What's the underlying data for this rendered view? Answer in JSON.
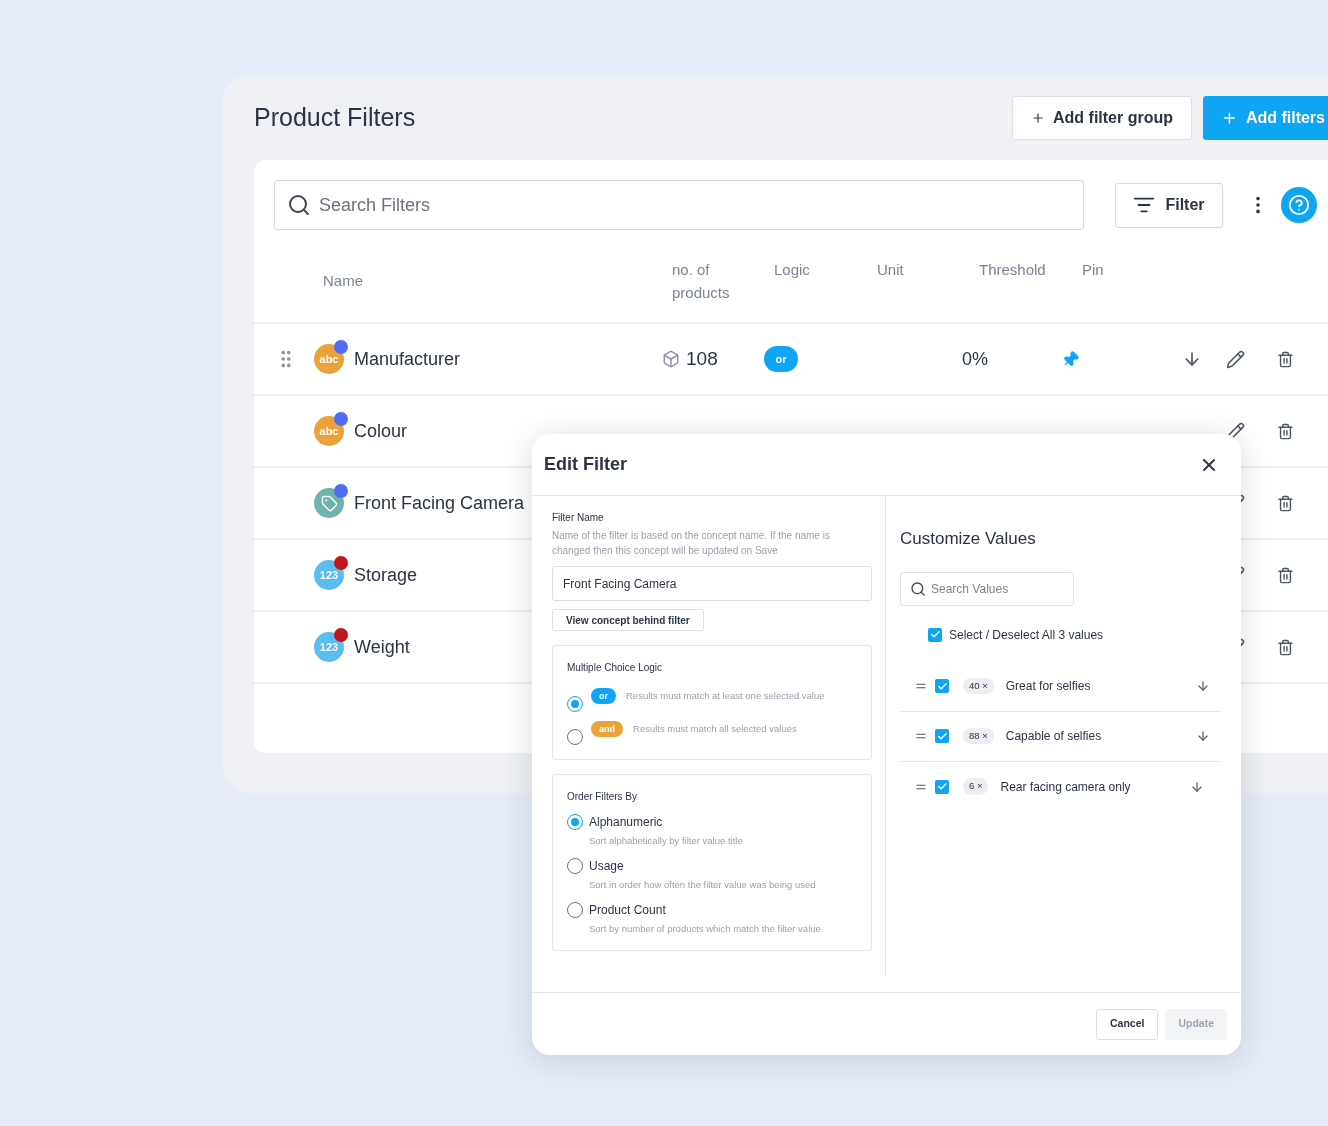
{
  "page": {
    "title": "Product Filters",
    "buttons": [
      {
        "label": "Add filter group",
        "kind": "secondary"
      },
      {
        "label": "Add filters",
        "kind": "primary"
      }
    ]
  },
  "toolbar": {
    "search_placeholder": "Search Filters",
    "filter_button": "Filter"
  },
  "table": {
    "columns": [
      "Name",
      "no. of products",
      "Logic",
      "Unit",
      "Threshold",
      "Pin"
    ],
    "rows": [
      {
        "name": "Manufacturer",
        "kind": "text",
        "type_label": "abc",
        "color": "#4f6ef7",
        "count": "108",
        "logic": "or",
        "threshold": "0%",
        "pinned": true,
        "sort_descending": true,
        "drag": true
      },
      {
        "name": "Colour",
        "kind": "text",
        "type_label": "abc",
        "color": "#4f6ef7",
        "drag": false
      },
      {
        "name": "Front Facing Camera",
        "kind": "tag",
        "color": "#4f6ef7",
        "drag": false
      },
      {
        "name": "Storage",
        "kind": "number",
        "type_label": "123",
        "color": "#c0161c",
        "drag": false
      },
      {
        "name": "Weight",
        "kind": "number",
        "type_label": "123",
        "color": "#c0161c",
        "drag": false
      }
    ]
  },
  "dialog": {
    "title": "Edit Filter",
    "filter_name": {
      "label": "Filter Name",
      "help": "Name of the filter is based on the concept name. If the name is changed then this concept will be updated on Save",
      "value": "Front Facing Camera"
    },
    "view_concept_button": "View concept behind filter",
    "logic": {
      "title": "Multiple Choice Logic",
      "options": [
        {
          "badge": "or",
          "kind": "or",
          "description": "Results must match at least one selected value",
          "selected": true
        },
        {
          "badge": "and",
          "kind": "and",
          "description": "Results must match all selected values",
          "selected": false
        }
      ]
    },
    "order": {
      "title": "Order Filters By",
      "options": [
        {
          "label": "Alphanumeric",
          "description": "Sort alphabetically by filter value title",
          "selected": true
        },
        {
          "label": "Usage",
          "description": "Sort in order how often the filter value was being used",
          "selected": false
        },
        {
          "label": "Product Count",
          "description": "Sort by number of products which match the filter value",
          "selected": false
        }
      ]
    },
    "customize": {
      "title": "Customize Values",
      "search_placeholder": "Search Values",
      "select_all": {
        "label": "Select / Deselect All 3 values",
        "checked": true
      },
      "values": [
        {
          "count": "40 ×",
          "label": "Great for selfies",
          "checked": true
        },
        {
          "count": "88 ×",
          "label": "Capable of selfies",
          "checked": true
        },
        {
          "count": "6 ×",
          "label": "Rear facing camera only",
          "checked": true
        }
      ]
    },
    "buttons": [
      {
        "label": "Cancel",
        "disabled": false
      },
      {
        "label": "Update",
        "disabled": true
      }
    ]
  }
}
